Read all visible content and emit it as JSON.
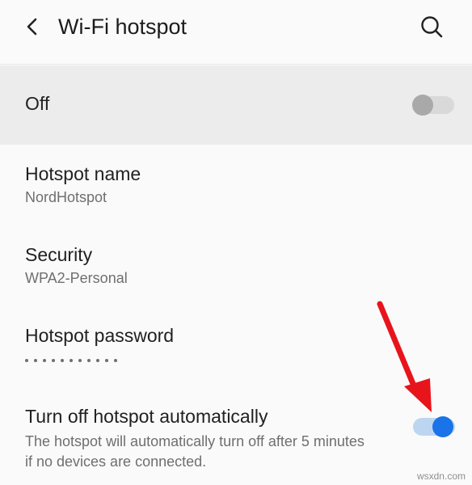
{
  "header": {
    "title": "Wi-Fi hotspot",
    "back_icon": "arrow-back-icon",
    "search_icon": "search-icon"
  },
  "master": {
    "label": "Off",
    "enabled": false
  },
  "items": {
    "hotspot_name": {
      "title": "Hotspot name",
      "value": "NordHotspot"
    },
    "security": {
      "title": "Security",
      "value": "WPA2-Personal"
    },
    "password": {
      "title": "Hotspot password",
      "masked_length": 11
    },
    "auto_off": {
      "title": "Turn off hotspot automatically",
      "description": "The hotspot will automatically turn off after 5 minutes if no devices are connected.",
      "enabled": true
    }
  },
  "colors": {
    "accent": "#1a73e8",
    "annotation_arrow": "#e8141c"
  },
  "watermark": "wsxdn.com"
}
